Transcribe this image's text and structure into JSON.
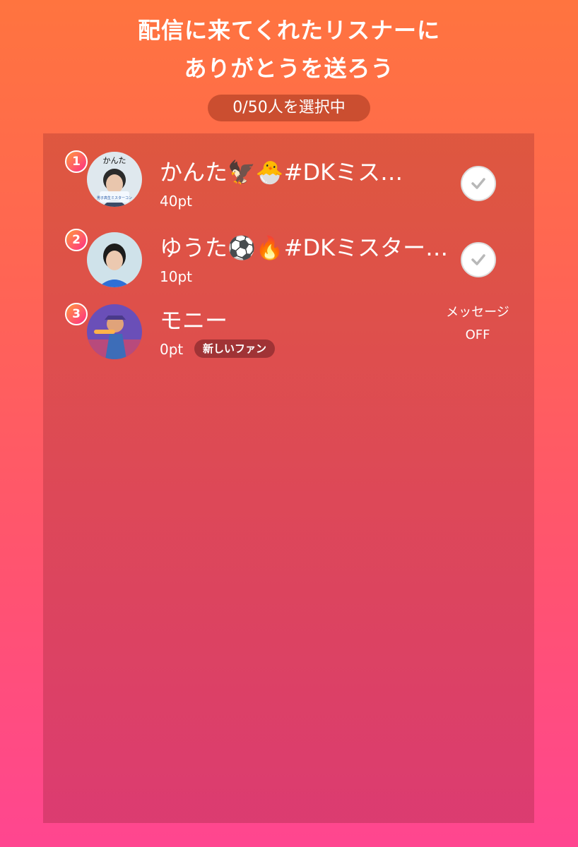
{
  "header": {
    "title_line1": "配信に来てくれたリスナーに",
    "title_line2": "ありがとうを送ろう",
    "selection_count": "0/50人を選択中"
  },
  "listeners": [
    {
      "rank": "1",
      "name": "かんた🦅🐣#DKミス…",
      "points": "40pt",
      "avatar_text": "かんた",
      "avatar_caption": "男子高生ミスターコン",
      "action": "check-button"
    },
    {
      "rank": "2",
      "name": "ゆうた⚽🔥#DKミスター…",
      "points": "10pt",
      "action": "check-button"
    },
    {
      "rank": "3",
      "name": "モニー",
      "points": "0pt",
      "badge": "新しいファン",
      "message_status_line1": "メッセージ",
      "message_status_line2": "OFF"
    }
  ],
  "colors": {
    "gradient_top": "#ff743f",
    "gradient_bottom": "#ff4690",
    "rank_badge": "#ff2d87",
    "check_icon": "#b8b8b8"
  }
}
